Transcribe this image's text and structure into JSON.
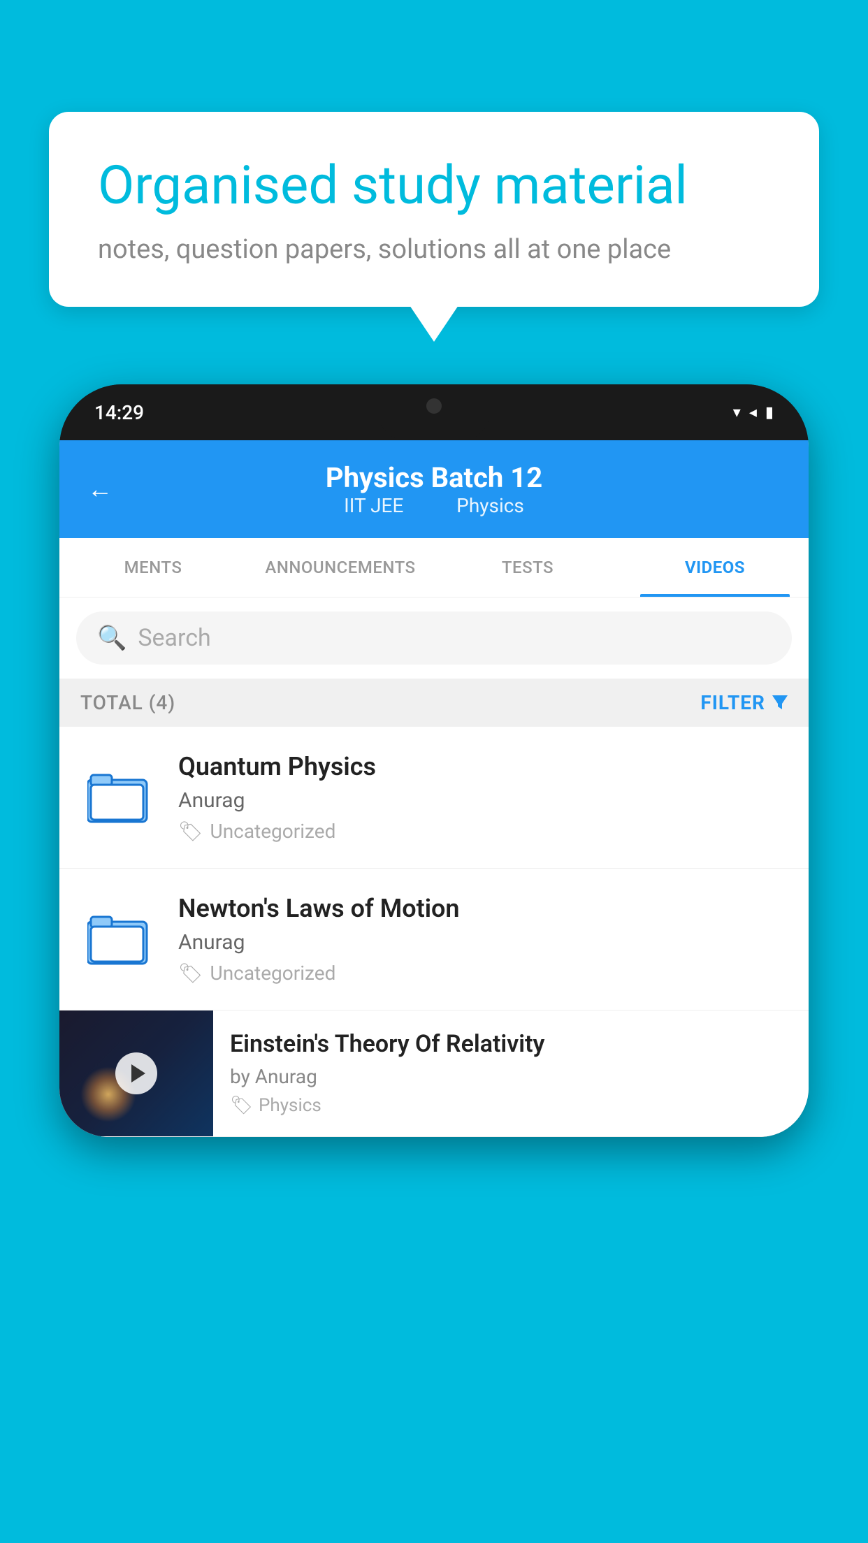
{
  "background_color": "#00BBDD",
  "speech_bubble": {
    "heading": "Organised study material",
    "subtext": "notes, question papers, solutions all at one place"
  },
  "phone": {
    "status_bar": {
      "time": "14:29",
      "signal_icons": "▾◂▮"
    },
    "header": {
      "title": "Physics Batch 12",
      "subtitle_left": "IIT JEE",
      "subtitle_right": "Physics",
      "back_label": "←"
    },
    "tabs": [
      {
        "label": "MENTS",
        "active": false
      },
      {
        "label": "ANNOUNCEMENTS",
        "active": false
      },
      {
        "label": "TESTS",
        "active": false
      },
      {
        "label": "VIDEOS",
        "active": true
      }
    ],
    "search": {
      "placeholder": "Search"
    },
    "filter_bar": {
      "total_label": "TOTAL (4)",
      "filter_label": "FILTER"
    },
    "video_items": [
      {
        "title": "Quantum Physics",
        "author": "Anurag",
        "tag": "Uncategorized",
        "has_thumb": false
      },
      {
        "title": "Newton's Laws of Motion",
        "author": "Anurag",
        "tag": "Uncategorized",
        "has_thumb": false
      },
      {
        "title": "Einstein's Theory Of Relativity",
        "author": "by Anurag",
        "tag": "Physics",
        "has_thumb": true
      }
    ]
  }
}
